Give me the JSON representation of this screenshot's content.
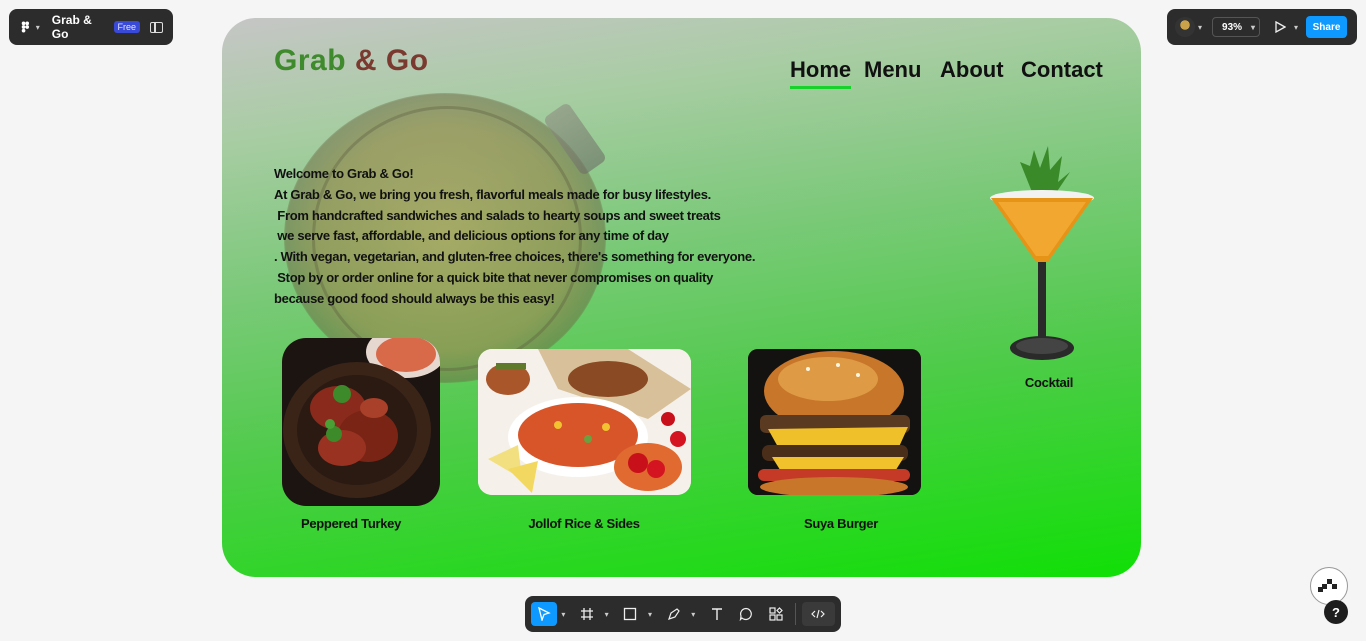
{
  "app": {
    "file_name": "Grab & Go",
    "plan_badge": "Free",
    "zoom": "93%",
    "share_label": "Share",
    "help_label": "?"
  },
  "site": {
    "brand_first": "Grab",
    "brand_second": "& Go",
    "nav": [
      "Home",
      "Menu",
      "About",
      "Contact"
    ],
    "intro_lines": [
      "Welcome to Grab & Go!",
      "At Grab & Go, we bring you fresh, flavorful meals made for busy lifestyles.",
      " From handcrafted sandwiches and salads to hearty soups and sweet treats",
      " we serve fast, affordable, and delicious options for any time of day",
      ". With vegan, vegetarian, and gluten-free choices, there's something for everyone.",
      " Stop by or order online for a quick bite that never compromises on quality",
      "because good food should always be this easy!"
    ],
    "dishes": [
      "Peppered Turkey",
      "Jollof Rice & Sides",
      "Suya Burger",
      "Cocktail"
    ]
  },
  "colors": {
    "brand_green": "#3e8a2c",
    "brand_red": "#7a3a30",
    "nav_underline": "#19d12b",
    "share_blue": "#0d99ff"
  },
  "icons": {
    "toolbar": [
      "move-icon",
      "frame-icon",
      "rectangle-icon",
      "pen-icon",
      "text-icon",
      "comment-icon",
      "components-icon",
      "dev-mode-icon"
    ]
  }
}
